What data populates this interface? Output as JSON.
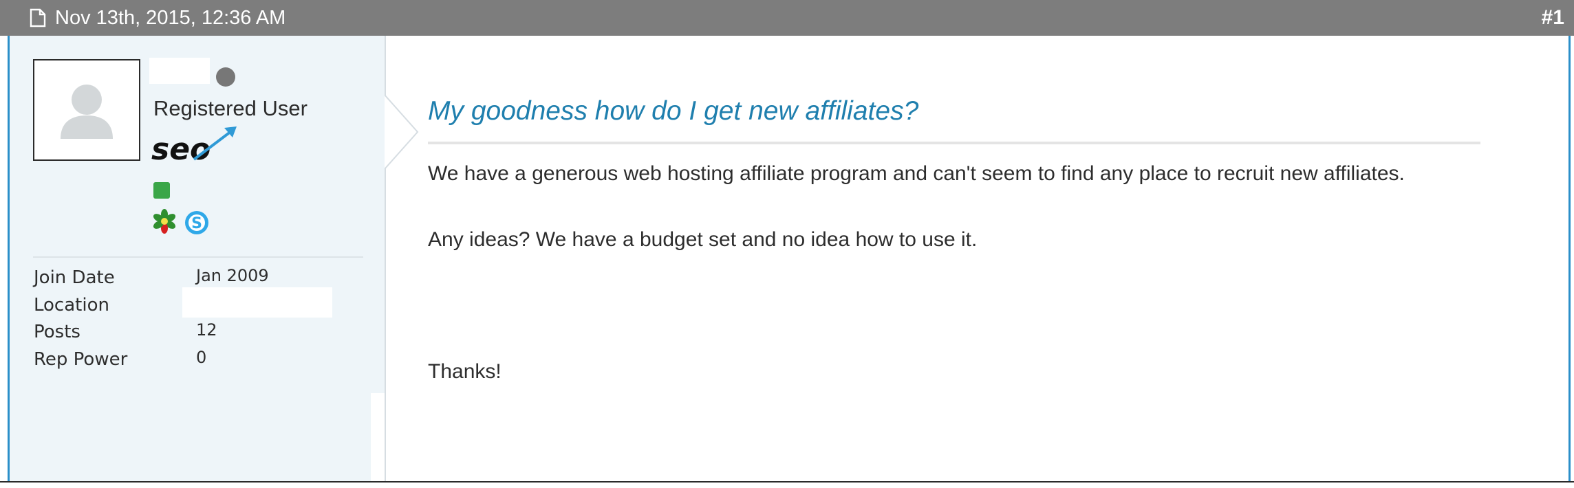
{
  "header": {
    "date": "Nov 13th, 2015, 12:36 AM",
    "post_number": "#1",
    "icon": "document-icon"
  },
  "author": {
    "title": "Registered User",
    "status_icon": "offline-status-dot",
    "rank_badge": "seo-badge",
    "online_icon": "online-indicator",
    "contact_icons": [
      "icq-icon",
      "skype-icon"
    ],
    "info": [
      {
        "label": "Join Date",
        "value": "Jan 2009"
      },
      {
        "label": "Location",
        "value": ""
      },
      {
        "label": "Posts",
        "value": "12"
      },
      {
        "label": "Rep Power",
        "value": "0"
      }
    ]
  },
  "post": {
    "title": "My goodness how do I get new affiliates?",
    "paragraphs": [
      "We have a generous web hosting affiliate program and can't seem to find any place to recruit new affiliates.",
      "Any ideas? We have a budget set and no idea how to use it.",
      "Thanks!"
    ]
  },
  "colors": {
    "header_bg": "#7d7d7d",
    "accent_border": "#2b8fc9",
    "title": "#1f7fae",
    "sidebar_bg": "#eef5f9",
    "online": "#3aa648"
  }
}
